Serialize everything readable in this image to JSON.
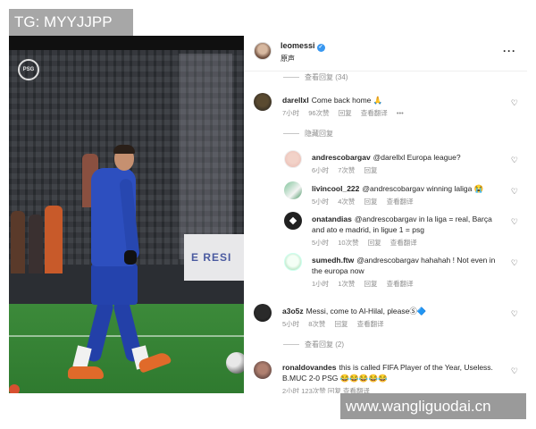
{
  "watermarks": {
    "top": "TG: MYYJJPP",
    "bottom": "www.wangliguodai.cn"
  },
  "photo": {
    "adboard_text": "E RESI",
    "logo_text": "PSG"
  },
  "post": {
    "username": "leomessi",
    "verified_icon": "verified-badge-icon",
    "subtitle": "原声",
    "more_icon": "ellipsis-icon"
  },
  "view_replies_top": "查看回复 (34)",
  "comments": [
    {
      "username": "darellxl",
      "text": "Come back home 🙏",
      "time": "7小时",
      "likes": "96次赞",
      "reply": "回复",
      "translate": "查看翻译",
      "more": "•••"
    }
  ],
  "hide_replies": "隐藏回复",
  "replies": [
    {
      "username": "andrescobargav",
      "text": "@darellxl Europa league?",
      "time": "6小时",
      "likes": "7次赞",
      "reply": "回复",
      "translate": ""
    },
    {
      "username": "livincool_222",
      "text": "@andrescobargav winning laliga 😭",
      "time": "5小时",
      "likes": "4次赞",
      "reply": "回复",
      "translate": "查看翻译"
    },
    {
      "username": "onatandias",
      "text": "@andrescobargav in la liga = real, Barça and ato e madrid, in ligue 1 = psg",
      "time": "5小时",
      "likes": "10次赞",
      "reply": "回复",
      "translate": "查看翻译"
    },
    {
      "username": "sumedh.ftw",
      "text": "@andrescobargav hahahah ! Not even in the europa now",
      "time": "1小时",
      "likes": "1次赞",
      "reply": "回复",
      "translate": "查看翻译"
    }
  ],
  "comments2": [
    {
      "username": "a3o5z",
      "text": "Messi, come to Al-Hilal, pleaseⓈ🔷",
      "time": "5小时",
      "likes": "8次赞",
      "reply": "回复",
      "translate": "查看翻译"
    }
  ],
  "view_replies_bottom": "查看回复 (2)",
  "comments3": [
    {
      "username": "ronaldovandes",
      "text": "this is called FIFA Player of the Year, Useless. B.MUC 2-0 PSG 😂😂😂😂😂",
      "meta": "2小时 123次赞 回复 查看翻译"
    }
  ]
}
